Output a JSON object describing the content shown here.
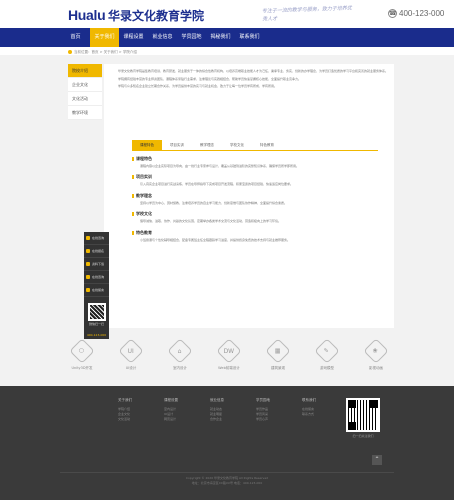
{
  "header": {
    "logo_en": "Hualu",
    "logo_cn": "华录文化教育学院",
    "slogan": "专注于一流的教学与服务，致力于培养优秀人才",
    "phone": "400-123-000"
  },
  "nav": [
    "首页",
    "关于我们",
    "课程设置",
    "就业信息",
    "学员园地",
    "揭秘我们",
    "联系我们"
  ],
  "breadcrumb": "当前位置：首页 > 关于我们 > 学院介绍",
  "sidebar": [
    "院校介绍",
    "企业文化",
    "文化活动",
    "教学环境"
  ],
  "side_tools": {
    "items": [
      "在线咨询",
      "在线报名",
      "资料下载",
      "在线咨询",
      "在线留言"
    ],
    "qr_label": "微信扫一扫",
    "phone": "400-123-000"
  },
  "main": {
    "intro": [
      "华录文化教育学院是集教育培训、教育研发、就业服务于一体的综合性教育机构，以培养高端职业技能人才为己任，秉承专业、务实、创新的办学理念，为学员打造优质的学习平台和完善的就业服务体系。",
      "学院拥有经验丰富的专业师资团队，课程体系紧贴行业需求，注重理论与实践相结合，帮助学员快速掌握核心技能，全面提升职业竞争力。",
      "学院与众多知名企业建立长期合作关系，为学员提供丰富的实习与就业机会，致力于让每一位学员学有所成、学有所用。"
    ],
    "tabs": [
      "课程特色",
      "项目实训",
      "教学理念",
      "学校文化",
      "特色教育"
    ],
    "sections": [
      {
        "title": "课程特色",
        "text": "课程内容以企业实际项目为导向，由一线行业专家参与设计，覆盖从基础到进阶的完整知识体系，确保学员所学即所用。"
      },
      {
        "title": "项目实训",
        "text": "引入真实企业项目进行实战演练，学员在导师指导下完成项目开发流程，积累宝贵的项目经验，快速适应岗位要求。"
      },
      {
        "title": "教学理念",
        "text": "坚持以学员为中心，因材施教，注重培养学员的自主学习能力、创新思维与团队协作精神，全面提升综合素质。"
      },
      {
        "title": "学校文化",
        "text": "倡导诚信、进取、协作、共赢的文化氛围，定期举办各类学术交流与文化活动，营造积极向上的学习环境。"
      },
      {
        "title": "特色教育",
        "text": "小班授课与个性化辅导相结合，配备专属班主任全程跟踪学习进度，并提供终身免费的技术支持与就业推荐服务。"
      }
    ]
  },
  "features": [
    {
      "icon": "hexagon-icon",
      "glyph": "⬡",
      "label": "Unity3D开发"
    },
    {
      "icon": "ui-icon",
      "glyph": "UI",
      "label": "UI设计"
    },
    {
      "icon": "interior-icon",
      "glyph": "⌂",
      "label": "室内设计"
    },
    {
      "icon": "web-icon",
      "glyph": "DW",
      "label": "Web前端设计"
    },
    {
      "icon": "building-icon",
      "glyph": "▦",
      "label": "建筑景观"
    },
    {
      "icon": "product-icon",
      "glyph": "✎",
      "label": "游戏模型"
    },
    {
      "icon": "art-icon",
      "glyph": "❀",
      "label": "影视动画"
    }
  ],
  "footer": {
    "columns": [
      {
        "head": "关于我们",
        "links": [
          "学院介绍",
          "企业文化",
          "文化活动"
        ]
      },
      {
        "head": "课程设置",
        "links": [
          "室内设计",
          "UI设计",
          "网页设计"
        ]
      },
      {
        "head": "就业信息",
        "links": [
          "就业动态",
          "就业明星",
          "合作企业"
        ]
      },
      {
        "head": "学员园地",
        "links": [
          "学员作品",
          "学员风采",
          "学员心声"
        ]
      },
      {
        "head": "联系我们",
        "links": [
          "在线留言",
          "联系方式"
        ]
      }
    ],
    "qr_label": "扫一扫关注我们",
    "copyright_1": "Copyright © 2020 华录文化教育学院 All Rights Reserved",
    "copyright_2": "地址：北京市海淀区XX路XX号 电话：400-123-000"
  }
}
